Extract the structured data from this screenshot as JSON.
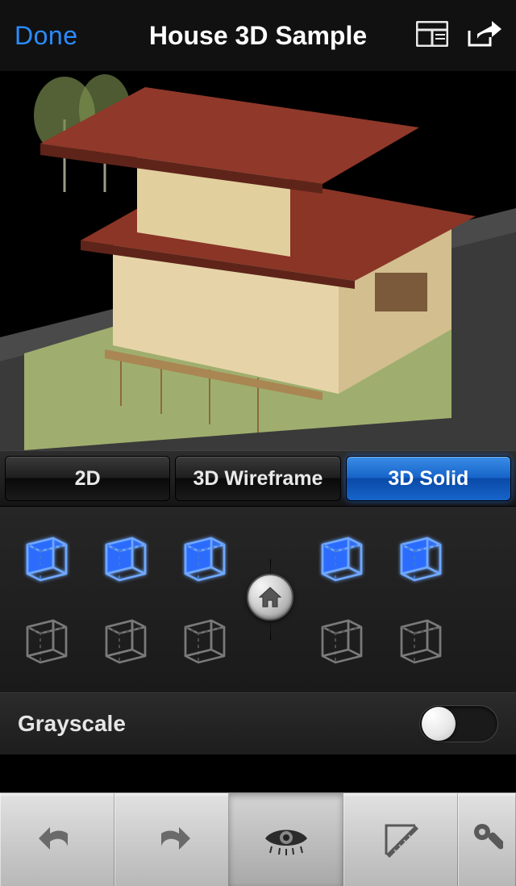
{
  "header": {
    "done_label": "Done",
    "title": "House 3D Sample"
  },
  "view_modes": {
    "tabs": [
      {
        "id": "2d",
        "label": "2D",
        "active": false
      },
      {
        "id": "3d-wireframe",
        "label": "3D Wireframe",
        "active": false
      },
      {
        "id": "3d-solid",
        "label": "3D Solid",
        "active": true
      }
    ]
  },
  "view_cubes": {
    "left": [
      {
        "id": "top-sw",
        "lit": true
      },
      {
        "id": "top-front",
        "lit": true
      },
      {
        "id": "top-se",
        "lit": true
      },
      {
        "id": "bottom-sw",
        "lit": false
      },
      {
        "id": "bottom-front",
        "lit": false
      },
      {
        "id": "bottom-se",
        "lit": false
      }
    ],
    "right": [
      {
        "id": "iso-ne",
        "lit": true
      },
      {
        "id": "iso-nw",
        "lit": true
      },
      {
        "id": "iso-se",
        "lit": false
      },
      {
        "id": "iso-sw",
        "lit": false
      }
    ],
    "home_button": "home-view"
  },
  "options": {
    "grayscale_label": "Grayscale",
    "grayscale_on": false
  },
  "bottom_tools": [
    {
      "id": "undo",
      "icon": "undo-icon",
      "active": false
    },
    {
      "id": "redo",
      "icon": "redo-icon",
      "active": false
    },
    {
      "id": "visibility",
      "icon": "eye-icon",
      "active": true
    },
    {
      "id": "measure",
      "icon": "ruler-icon",
      "active": false
    },
    {
      "id": "more",
      "icon": "wrench-icon",
      "active": false
    }
  ],
  "colors": {
    "accent": "#2b8cff",
    "cube_glow": "#2a6bff"
  }
}
